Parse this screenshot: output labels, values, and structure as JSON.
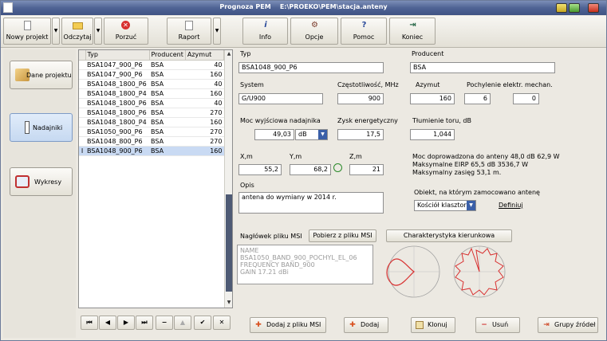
{
  "window": {
    "title": "Prognoza PEM    E:\\PROEKO\\PEM\\stacja.anteny"
  },
  "toolbar": {
    "new_project": "Nowy projekt",
    "open": "Odczytaj",
    "discard": "Porzuć",
    "report": "Raport",
    "info": "Info",
    "options": "Opcje",
    "help": "Pomoc",
    "exit": "Koniec"
  },
  "nav": {
    "project_data": "Dane projektu",
    "transmitters": "Nadajniki",
    "charts": "Wykresy"
  },
  "grid": {
    "columns": [
      "Typ",
      "Producent",
      "Azymut"
    ],
    "rows": [
      {
        "typ": "BSA1047_900_P6",
        "prod": "BSA",
        "az": "40"
      },
      {
        "typ": "BSA1047_900_P6",
        "prod": "BSA",
        "az": "160"
      },
      {
        "typ": "BSA1048_1800_P6",
        "prod": "BSA",
        "az": "40"
      },
      {
        "typ": "BSA1048_1800_P4",
        "prod": "BSA",
        "az": "160"
      },
      {
        "typ": "BSA1048_1800_P6",
        "prod": "BSA",
        "az": "40"
      },
      {
        "typ": "BSA1048_1800_P6",
        "prod": "BSA",
        "az": "270"
      },
      {
        "typ": "BSA1048_1800_P4",
        "prod": "BSA",
        "az": "160"
      },
      {
        "typ": "BSA1050_900_P6",
        "prod": "BSA",
        "az": "270"
      },
      {
        "typ": "BSA1048_800_P6",
        "prod": "BSA",
        "az": "270"
      },
      {
        "typ": "BSA1048_900_P6",
        "prod": "BSA",
        "az": "160",
        "selected": true
      }
    ]
  },
  "form": {
    "typ_label": "Typ",
    "typ_value": "BSA1048_900_P6",
    "producent_label": "Producent",
    "producent_value": "BSA",
    "system_label": "System",
    "system_value": "G/U900",
    "freq_label": "Częstotliwość, MHz",
    "freq_value": "900",
    "azymut_label": "Azymut",
    "azymut_value": "160",
    "tilt_label": "Pochylenie elektr.  mechan.",
    "tilt_el_value": "6",
    "tilt_mech_value": "0",
    "power_label": "Moc wyjściowa nadajnika",
    "power_value": "49,03",
    "unit_value": "dB",
    "gain_label": "Zysk energetyczny",
    "gain_value": "17,5",
    "atten_label": "Tłumienie toru, dB",
    "atten_value": "1,044",
    "x_label": "X,m",
    "x_value": "55,2",
    "y_label": "Y,m",
    "y_value": "68,2",
    "z_label": "Z,m",
    "z_value": "21",
    "info_line1": "Moc doprowadzona do anteny 48,0 dB  62,9 W",
    "info_line2": "Maksymalne EIRP 65,5 dB  3536,7 W",
    "info_line3": "Maksymalny zasięg 53,1 m.",
    "opis_label": "Opis",
    "opis_value": "antena do wymiany w 2014 r.",
    "object_label": "Obiekt, na którym zamocowano antenę",
    "object_value": "Kościół klasztorny",
    "define_link": "Definiuj",
    "msi_header_label": "Nagłówek pliku MSI",
    "msi_fetch_button": "Pobierz z pliku MSI",
    "characteristic_button": "Charakterystyka kierunkowa",
    "msi_line1": "NAME",
    "msi_line2": "BSA1050_BAND_900_POCHYL_EL_06",
    "msi_line3": "FREQUENCY BAND_900",
    "msi_line4": "GAIN 17.21 dBi"
  },
  "bottom": {
    "add_msi": "Dodaj z pliku MSI",
    "add": "Dodaj",
    "clone": "Klonuj",
    "delete": "Usuń",
    "groups": "Grupy źródeł"
  },
  "colors": {
    "pattern_line": "#d83030",
    "title_bar": "#4f6394",
    "selection": "#c9daf3"
  }
}
